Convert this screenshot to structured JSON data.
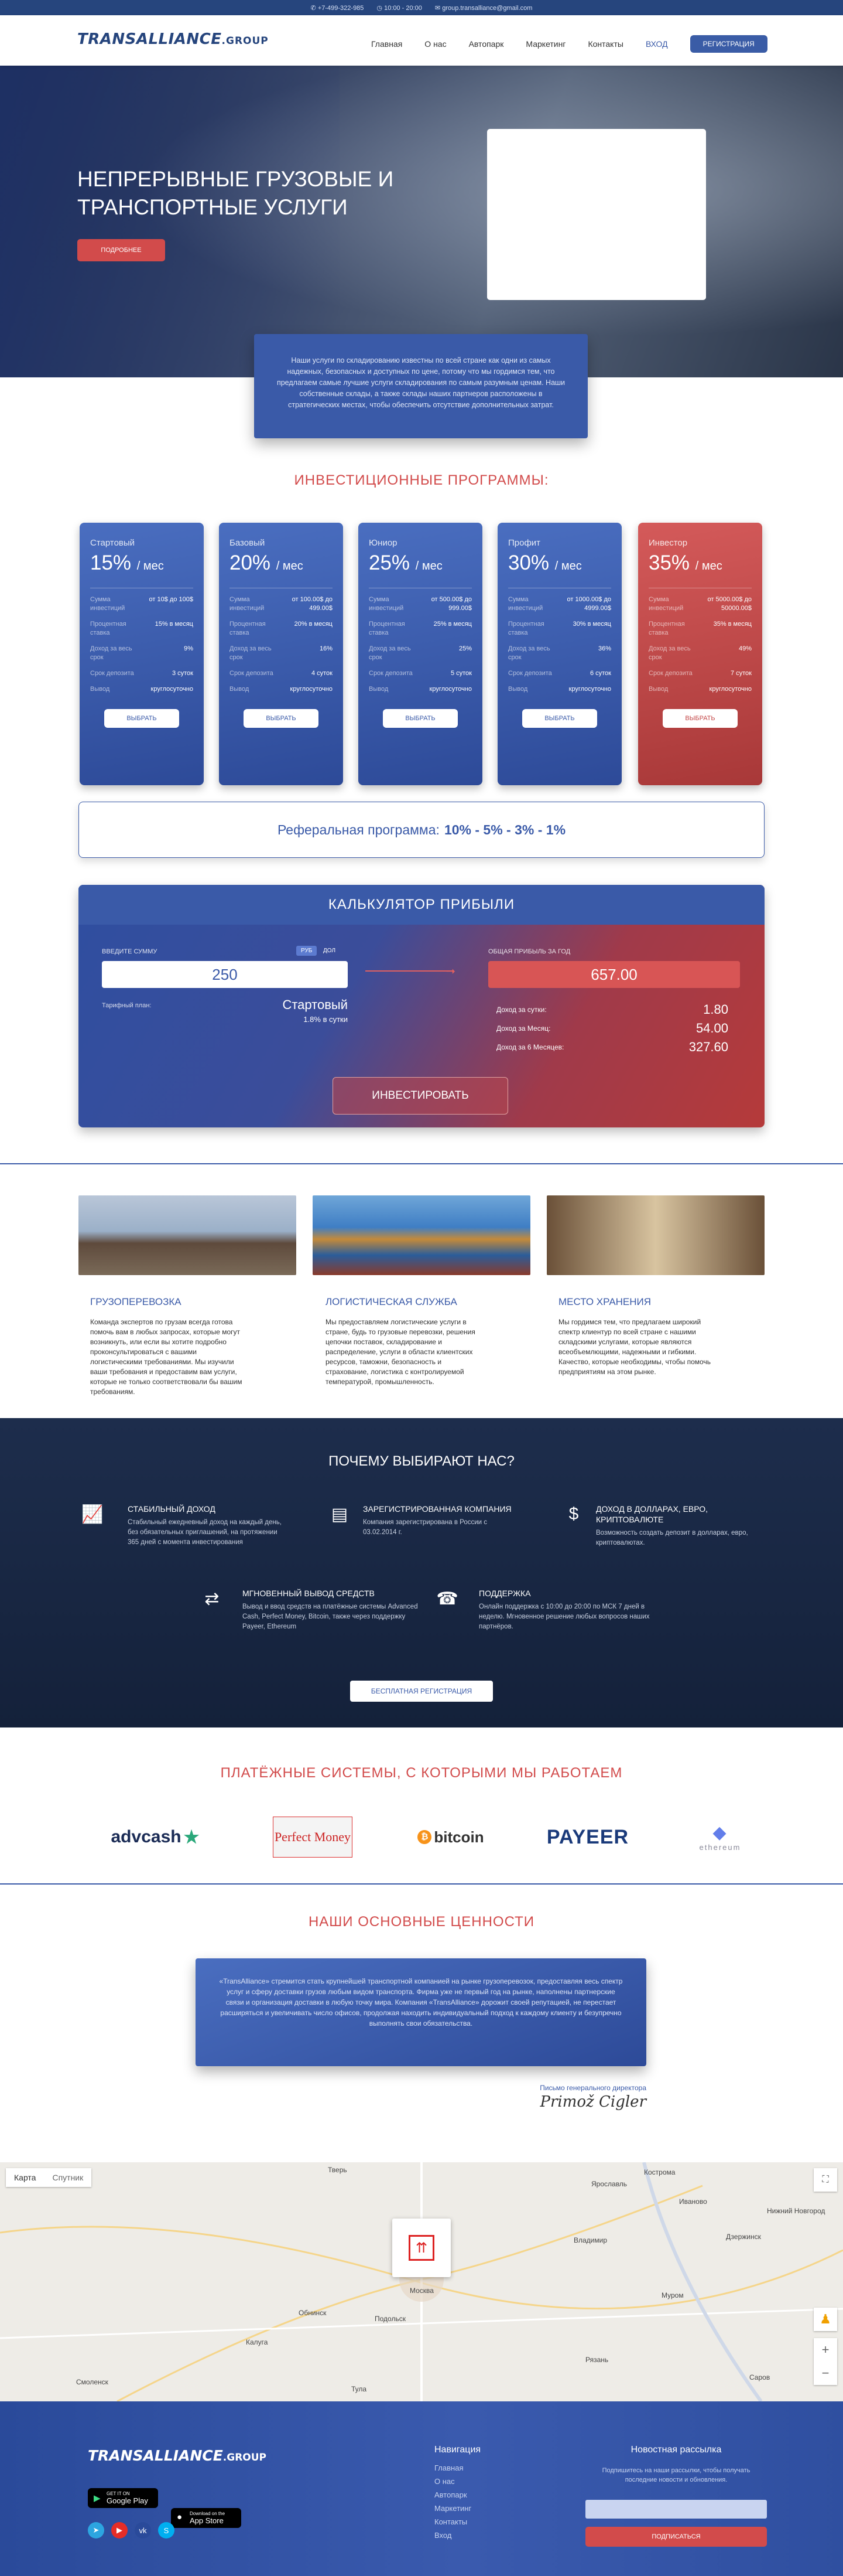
{
  "topbar": {
    "phone": "+7-499-322-985",
    "hours": "10:00 - 20:00",
    "email": "group.transalliance@gmail.com"
  },
  "header": {
    "logo": "TRANSALLIANCE",
    "logo_suffix": ".GROUP",
    "menu": [
      "Главная",
      "О нас",
      "Автопарк",
      "Маркетинг",
      "Контакты"
    ],
    "login": "ВХОД",
    "register": "РЕГИСТРАЦИЯ"
  },
  "hero": {
    "title": "НЕПРЕРЫВНЫЕ ГРУЗОВЫЕ И ТРАНСПОРТНЫЕ УСЛУГИ",
    "button": "ПОДРОБНЕЕ"
  },
  "intro": {
    "text": "Наши услуги по складированию известны по всей стране как одни из самых надежных, безопасных и доступных по цене, потому что мы гордимся тем, что предлагаем самые лучшие услуги складирования по самым разумным ценам. Наши собственные склады, а также склады наших партнеров расположены в стратегических местах, чтобы обеспечить отсутствие дополнительных затрат."
  },
  "programs": {
    "title": "ИНВЕСТИЦИОННЫЕ ПРОГРАММЫ:",
    "labels": {
      "sum": "Сумма инвестиций",
      "rate": "Процентная ставка",
      "income": "Доход за весь срок",
      "term": "Срок депозита",
      "withdraw": "Вывод"
    },
    "button": "ВЫБРАТЬ",
    "period": "/ мес",
    "items": [
      {
        "name": "Стартовый",
        "percent": "15%",
        "sum": "от 10$ до 100$",
        "rate": "15% в месяц",
        "income": "9%",
        "term": "3 суток",
        "withdraw": "круглосуточно"
      },
      {
        "name": "Базовый",
        "percent": "20%",
        "sum": "от 100.00$ до 499.00$",
        "rate": "20% в месяц",
        "income": "16%",
        "term": "4 суток",
        "withdraw": "круглосуточно"
      },
      {
        "name": "Юниор",
        "percent": "25%",
        "sum": "от 500.00$ до 999.00$",
        "rate": "25% в месяц",
        "income": "25%",
        "term": "5 суток",
        "withdraw": "круглосуточно"
      },
      {
        "name": "Профит",
        "percent": "30%",
        "sum": "от 1000.00$ до 4999.00$",
        "rate": "30% в месяц",
        "income": "36%",
        "term": "6 суток",
        "withdraw": "круглосуточно"
      },
      {
        "name": "Инвестор",
        "percent": "35%",
        "sum": "от 5000.00$ до 50000.00$",
        "rate": "35% в месяц",
        "income": "49%",
        "term": "7 суток",
        "withdraw": "круглосуточно"
      }
    ]
  },
  "referral": {
    "label": "Реферальная программа:",
    "levels": "10% - 5% - 3% - 1%"
  },
  "calc": {
    "title": "КАЛЬКУЛЯТОР ПРИБЫЛИ",
    "input_label": "ВВЕДИТЕ СУММУ",
    "cur_rub": "РУБ",
    "cur_usd": "ДОЛ",
    "amount": "250",
    "plan_label": "Тарифный план:",
    "plan_name": "Стартовый",
    "plan_rate": "1.8% в сутки",
    "total_label": "ОБЩАЯ ПРИБЫЛЬ ЗА ГОД",
    "total": "657.00",
    "day_label": "Доход за сутки:",
    "day": "1.80",
    "month_label": "Доход за Месяц:",
    "month": "54.00",
    "half_label": "Доход за 6 Месяцев:",
    "half": "327.60",
    "button": "ИНВЕСТИРОВАТЬ"
  },
  "services": [
    {
      "title": "ГРУЗОПЕРЕВОЗКА",
      "text": "Команда экспертов по грузам всегда готова помочь вам в любых запросах, которые могут возникнуть, или если вы хотите подробно проконсультироваться с вашими логистическими требованиями. Мы изучили ваши требования и предоставим вам услуги, которые не только соответствовали бы вашим требованиям."
    },
    {
      "title": "ЛОГИСТИЧЕСКАЯ СЛУЖБА",
      "text": "Мы предоставляем логистические услуги в стране, будь то грузовые перевозки, решения цепочки поставок, складирование и распределение, услуги в области клиентских ресурсов, таможни, безопасность и страхование, логистика с контролируемой температурой, промышленность."
    },
    {
      "title": "МЕСТО ХРАНЕНИЯ",
      "text": "Мы гордимся тем, что предлагаем широкий спектр клиентур по всей стране с нашими складскими услугами, которые являются всеобъемлющими, надежными и гибкими. Качество, которые необходимы, чтобы помочь предприятиям на этом рынке."
    }
  ],
  "why": {
    "title": "ПОЧЕМУ ВЫБИРАЮТ НАС?",
    "items": [
      {
        "icon": "chart-icon",
        "title": "СТАБИЛЬНЫЙ ДОХОД",
        "text": "Стабильный ежедневный доход на каждый день, без обязательных приглашений, на протяжении 365 дней с момента инвестирования"
      },
      {
        "icon": "certificate-icon",
        "title": "ЗАРЕГИСТРИРОВАННАЯ КОМПАНИЯ",
        "text": "Компания зарегистрирована в России с 03.02.2014 г."
      },
      {
        "icon": "money-hand-icon",
        "title": "ДОХОД В ДОЛЛАРАХ, ЕВРО, КРИПТОВАЛЮТЕ",
        "text": "Возможность создать депозит в долларах, евро, криптовалютах."
      },
      {
        "icon": "withdraw-icon",
        "title": "МГНОВЕННЫЙ ВЫВОД СРЕДСТВ",
        "text": "Вывод и ввод средств на платёжные системы Advanced Cash, Perfect Money, Bitcoin, также через поддержку Payeer, Ethereum"
      },
      {
        "icon": "support-icon",
        "title": "ПОДДЕРЖКА",
        "text": "Онлайн поддержка с 10:00 до 20:00 по МСК 7 дней в неделю. Мгновенное решение любых вопросов наших партнёров."
      }
    ],
    "button": "БЕСПЛАТНАЯ РЕГИСТРАЦИЯ"
  },
  "payments": {
    "title": "ПЛАТЁЖНЫЕ СИСТЕМЫ, С КОТОРЫМИ МЫ РАБОТАЕМ",
    "logos": [
      "advcash",
      "Perfect Money",
      "bitcoin",
      "PAYEER",
      "ethereum"
    ]
  },
  "values": {
    "title": "НАШИ ОСНОВНЫЕ ЦЕННОСТИ",
    "text": "«TransAlliance» стремится стать крупнейшей транспортной компанией на рынке грузоперевозок, предоставляя весь спектр услуг и сферу доставки грузов любым видом транспорта. Фирма уже не первый год на рынке, наполнены партнерские связи и организация доставки в любую точку мира. Компания «TransAlliance» дорожит своей репутацией, не перестает расширяться и увеличивать число офисов, продолжая находить индивидуальный подход к каждому клиенту и безупречно выполнять свои обязательства.",
    "signature_label": "Письмо генерального директора",
    "signature": "Primož Cigler"
  },
  "map": {
    "tab_map": "Карта",
    "tab_sat": "Спутник",
    "cities": [
      {
        "n": "Тверь"
      },
      {
        "n": "Ярославль"
      },
      {
        "n": "Москва"
      },
      {
        "n": "Владимир"
      },
      {
        "n": "Нижний Новгород"
      },
      {
        "n": "Рязань"
      },
      {
        "n": "Тула"
      },
      {
        "n": "Калуга"
      },
      {
        "n": "Смоленск"
      },
      {
        "n": "Подольск"
      },
      {
        "n": "Обнинск"
      },
      {
        "n": "Иваново"
      },
      {
        "n": "Дзержинск"
      },
      {
        "n": "Саров"
      },
      {
        "n": "Муром"
      },
      {
        "n": "Кострома"
      }
    ]
  },
  "footer": {
    "logo": "TRANSALLIANCE",
    "logo_suffix": ".GROUP",
    "nav_title": "Навигация",
    "nav": [
      "Главная",
      "О нас",
      "Автопарк",
      "Маркетинг",
      "Контакты",
      "Вход"
    ],
    "google_small": "GET IT ON",
    "google": "Google Play",
    "apple_small": "Download on the",
    "apple": "App Store",
    "news_title": "Новостная рассылка",
    "news_text": "Подпишитесь на наши рассылки, чтобы получать последние новости и обновления.",
    "subscribe": "ПОДПИСАТЬСЯ"
  },
  "colors": {
    "brand": "#3a5aa8",
    "accent": "#d24b4b",
    "dark": "#1d2d4c"
  }
}
